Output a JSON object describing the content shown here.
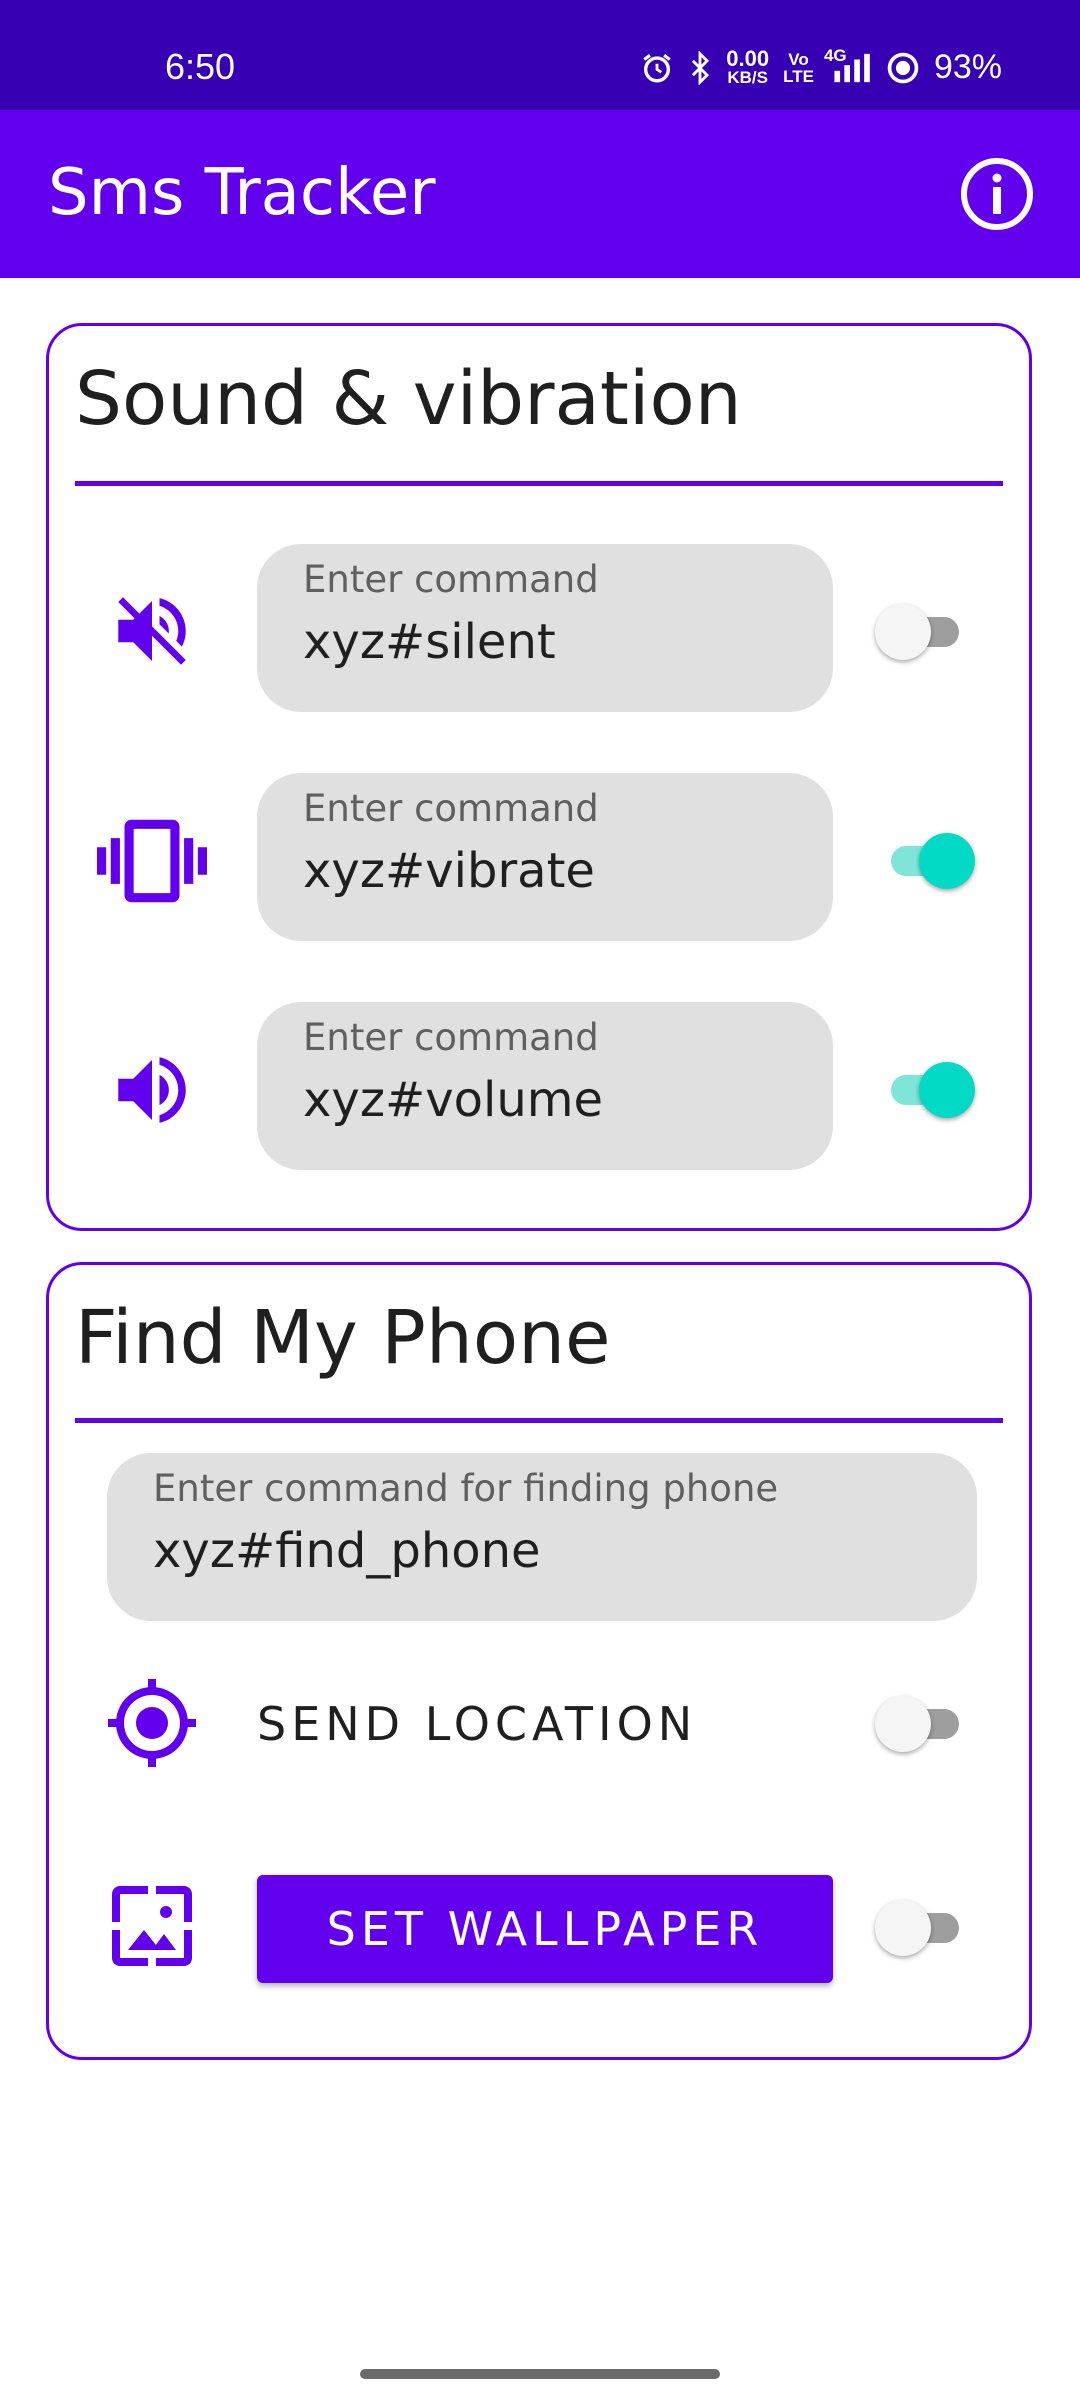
{
  "status_bar": {
    "time": "6:50",
    "net_speed_value": "0.00",
    "net_speed_unit": "KB/S",
    "volte_top": "Vo",
    "volte_bottom": "LTE",
    "network": "4G",
    "battery": "93%",
    "icons": [
      "alarm-icon",
      "bluetooth-icon",
      "signal-icon",
      "battery-icon"
    ]
  },
  "app_bar": {
    "title": "Sms Tracker",
    "action_icon": "info-icon"
  },
  "sound_card": {
    "title": "Sound & vibration",
    "rows": [
      {
        "icon": "volume-off-icon",
        "label": "Enter command",
        "value": "xyz#silent",
        "enabled": false
      },
      {
        "icon": "vibrate-icon",
        "label": "Enter command",
        "value": "xyz#vibrate",
        "enabled": true
      },
      {
        "icon": "volume-up-icon",
        "label": "Enter command",
        "value": "xyz#volume",
        "enabled": true
      }
    ]
  },
  "find_card": {
    "title": "Find My Phone",
    "find_field": {
      "label": "Enter command for finding phone",
      "value": "xyz#find_phone"
    },
    "send_location": {
      "icon": "my-location-icon",
      "label": "SEND LOCATION",
      "enabled": false
    },
    "set_wallpaper": {
      "icon": "wallpaper-icon",
      "label": "SET WALLPAPER",
      "enabled": false
    }
  },
  "colors": {
    "status_bar": "#3700b3",
    "primary": "#6200ee",
    "switch_on": "#03dac5",
    "field_bg": "#e0e0e0"
  }
}
